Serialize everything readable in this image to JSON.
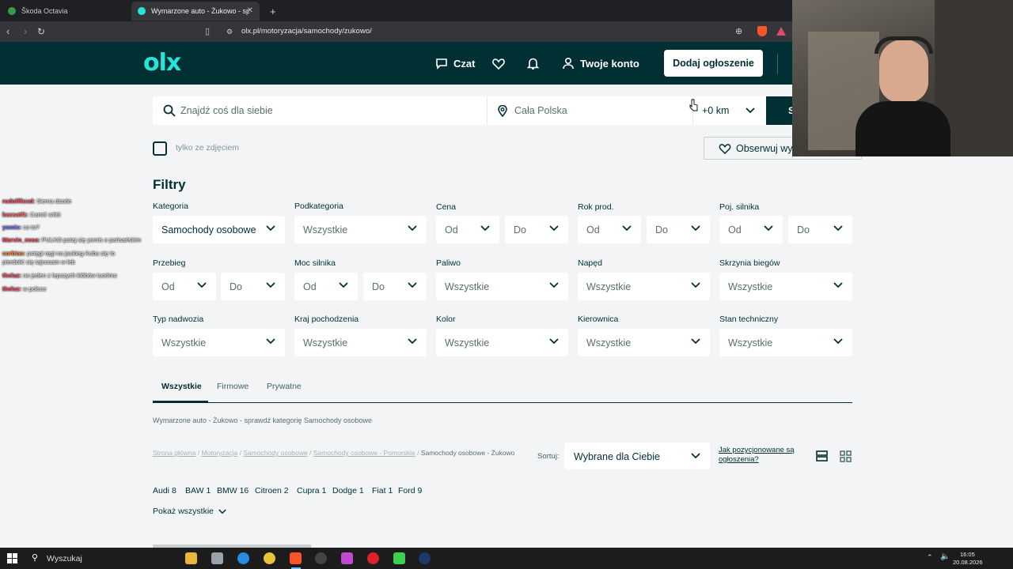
{
  "browser": {
    "tabs": [
      {
        "label": "Škoda Octavia",
        "active": false
      },
      {
        "label": "Wymarzone auto - Żukowo - sp",
        "active": true
      }
    ],
    "new_tab": "+",
    "url": "olx.pl/motoryzacja/samochody/zukowo/"
  },
  "header": {
    "logo": "olx",
    "chat_label": "Czat",
    "account_label": "Twoje konto",
    "add_button": "Dodaj ogłoszenie"
  },
  "search": {
    "query_placeholder": "Znajdź coś dla siebie",
    "location_placeholder": "Cała Polska",
    "radius": "+0 km",
    "button_label": "S",
    "only_photos_label": "tylko ze zdjęciem",
    "observe_label": "Obserwuj wy"
  },
  "filters": {
    "title": "Filtry",
    "row1": {
      "kategoria": {
        "label": "Kategoria",
        "value": "Samochody osobowe"
      },
      "podkategoria": {
        "label": "Podkategoria",
        "value": "Wszystkie"
      },
      "cena": {
        "label": "Cena",
        "from": "Od",
        "to": "Do"
      },
      "rok": {
        "label": "Rok prod.",
        "from": "Od",
        "to": "Do"
      },
      "poj": {
        "label": "Poj. silnika",
        "from": "Od",
        "to": "Do"
      }
    },
    "row2": {
      "przebieg": {
        "label": "Przebieg",
        "from": "Od",
        "to": "Do"
      },
      "moc": {
        "label": "Moc silnika",
        "from": "Od",
        "to": "Do"
      },
      "paliwo": {
        "label": "Paliwo",
        "value": "Wszystkie"
      },
      "naped": {
        "label": "Napęd",
        "value": "Wszystkie"
      },
      "skrzynia": {
        "label": "Skrzynia biegów",
        "value": "Wszystkie"
      }
    },
    "row3": {
      "nadwozie": {
        "label": "Typ nadwozia",
        "value": "Wszystkie"
      },
      "kraj": {
        "label": "Kraj pochodzenia",
        "value": "Wszystkie"
      },
      "kolor": {
        "label": "Kolor",
        "value": "Wszystkie"
      },
      "kierownica": {
        "label": "Kierownica",
        "value": "Wszystkie"
      },
      "stan": {
        "label": "Stan techniczny",
        "value": "Wszystkie"
      }
    }
  },
  "seller_tabs": [
    "Wszystkie",
    "Firmowe",
    "Prywatne"
  ],
  "category_hint": "Wymarzone auto - Żukowo - sprawdź kategorię Samochody osobowe",
  "breadcrumb": {
    "items": [
      "Strona główna",
      "Motoryzacja",
      "Samochody osobowe",
      "Samochody osobowe - Pomorskie"
    ],
    "current": "Samochody osobowe - Żukowo"
  },
  "sort": {
    "label": "Sortuj:",
    "value": "Wybrane dla Ciebie",
    "help_link": "Jak pozycjonowane są ogłoszenia?"
  },
  "brands": [
    {
      "name": "Audi",
      "count": "8"
    },
    {
      "name": "BAW",
      "count": "1"
    },
    {
      "name": "BMW",
      "count": "16"
    },
    {
      "name": "Citroen",
      "count": "2"
    },
    {
      "name": "Cupra",
      "count": "1"
    },
    {
      "name": "Dodge",
      "count": "1"
    },
    {
      "name": "Fiat",
      "count": "1"
    },
    {
      "name": "Ford",
      "count": "9"
    }
  ],
  "show_all": "Pokaż wszystkie",
  "chat_overlay": [
    {
      "user": "rudolfficxd:",
      "msg": "Siema dzode"
    },
    {
      "user": "bacsatf1:",
      "msg": "Camić witió"
    },
    {
      "user": "yomis:",
      "msg": "co to?"
    },
    {
      "user": "Marvin_essa:",
      "msg": "PULKO potaj się yomis o pańsańskim"
    },
    {
      "user": "corbias:",
      "msg": "potęgi ręgi na jaukieg Kuba się to"
    },
    {
      "user": "",
      "msg": "pierdolić się tajnosam w łeb"
    },
    {
      "user": "theluz:",
      "msg": "no jeden z lepszych kłóbów tuońmo"
    },
    {
      "user": "theluz:",
      "msg": "w polsce"
    }
  ],
  "taskbar": {
    "search_label": "Wyszukaj",
    "time": "16:05",
    "date": "20.08.2026"
  },
  "colors": {
    "olx_dark": "#002f34",
    "olx_teal": "#23e5db",
    "page_bg": "#f2f4f5"
  }
}
